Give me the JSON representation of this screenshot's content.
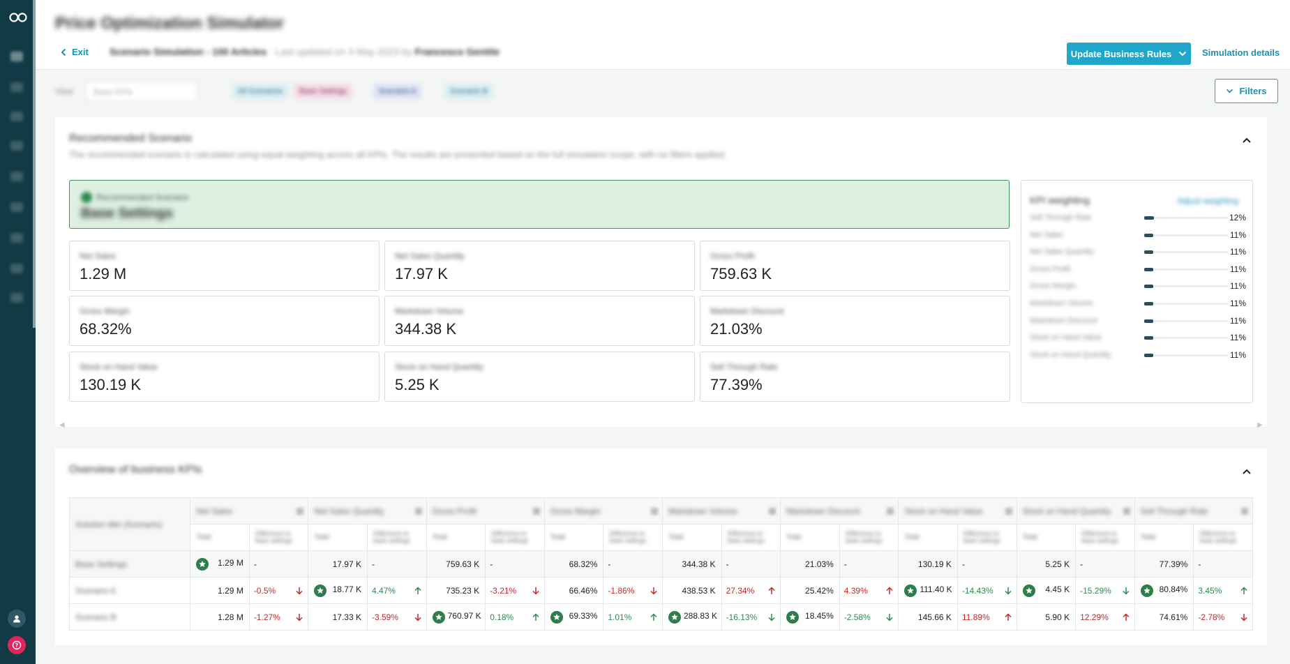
{
  "header": {
    "title": "Price Optimization Simulator",
    "exit_label": "Exit",
    "simulation_name": "Scenario Simulation - 100 Articles",
    "last_updated": "· Last updated on 3 May 2023 by",
    "updated_by": "Francesco Gentile",
    "update_rules_label": "Update Business Rules",
    "sim_details_label": "Simulation details"
  },
  "filter_bar": {
    "view_label": "View",
    "view_value": "Base KPIs",
    "chips": [
      "All Scenarios",
      "Base Settings",
      "Scenario A",
      "Scenario B"
    ],
    "filters_label": "Filters"
  },
  "recommended": {
    "title": "Recommended Scenario",
    "description": "The recommended scenario is calculated using equal weighting across all KPIs. The results are presented based on the full simulation scope, with no filters applied.",
    "banner_label": "Recommended Scenario",
    "banner_name": "Base Settings",
    "kpis": [
      {
        "label": "Net Sales",
        "value": "1.29 M"
      },
      {
        "label": "Net Sales Quantity",
        "value": "17.97 K"
      },
      {
        "label": "Gross Profit",
        "value": "759.63 K"
      },
      {
        "label": "Gross Margin",
        "value": "68.32%"
      },
      {
        "label": "Markdown Volume",
        "value": "344.38 K"
      },
      {
        "label": "Markdown Discount",
        "value": "21.03%"
      },
      {
        "label": "Stock on Hand Value",
        "value": "130.19 K"
      },
      {
        "label": "Stock on Hand Quantity",
        "value": "5.25 K"
      },
      {
        "label": "Sell Through Rate",
        "value": "77.39%"
      }
    ],
    "weighting": {
      "title": "KPI weighting",
      "link": "Adjust weighting",
      "rows": [
        {
          "label": "Sell Through Rate",
          "value": "12%",
          "fraction": 0.12
        },
        {
          "label": "Net Sales",
          "value": "11%",
          "fraction": 0.11
        },
        {
          "label": "Net Sales Quantity",
          "value": "11%",
          "fraction": 0.11
        },
        {
          "label": "Gross Profit",
          "value": "11%",
          "fraction": 0.11
        },
        {
          "label": "Gross Margin",
          "value": "11%",
          "fraction": 0.11
        },
        {
          "label": "Markdown Volume",
          "value": "11%",
          "fraction": 0.11
        },
        {
          "label": "Markdown Discount",
          "value": "11%",
          "fraction": 0.11
        },
        {
          "label": "Stock on Hand Value",
          "value": "11%",
          "fraction": 0.11
        },
        {
          "label": "Stock on Hand Quantity",
          "value": "11%",
          "fraction": 0.11
        }
      ]
    }
  },
  "overview": {
    "title": "Overview of business KPIs",
    "first_col_header": "Solution title (Scenario)",
    "columns": [
      "Net Sales",
      "Net Sales Quantity",
      "Gross Profit",
      "Gross Margin",
      "Markdown Volume",
      "Markdown Discount",
      "Stock on Hand Value",
      "Stock on Hand Quantity",
      "Sell Through Rate"
    ],
    "sub_total": "Total",
    "sub_diff": "Difference to base settings",
    "rows": [
      {
        "name": "Base Settings",
        "cells": [
          {
            "v": "1.29 M",
            "star": true,
            "d": "-",
            "dir": ""
          },
          {
            "v": "17.97 K",
            "star": false,
            "d": "-",
            "dir": ""
          },
          {
            "v": "759.63 K",
            "star": false,
            "d": "-",
            "dir": ""
          },
          {
            "v": "68.32%",
            "star": false,
            "d": "-",
            "dir": ""
          },
          {
            "v": "344.38 K",
            "star": false,
            "d": "-",
            "dir": ""
          },
          {
            "v": "21.03%",
            "star": false,
            "d": "-",
            "dir": ""
          },
          {
            "v": "130.19 K",
            "star": false,
            "d": "-",
            "dir": ""
          },
          {
            "v": "5.25 K",
            "star": false,
            "d": "-",
            "dir": ""
          },
          {
            "v": "77.39%",
            "star": false,
            "d": "-",
            "dir": ""
          }
        ]
      },
      {
        "name": "Scenario A",
        "cells": [
          {
            "v": "1.29 M",
            "star": false,
            "d": "-0.5%",
            "dir": "down",
            "tone": "neg"
          },
          {
            "v": "18.77 K",
            "star": true,
            "d": "4.47%",
            "dir": "up",
            "tone": "pos"
          },
          {
            "v": "735.23 K",
            "star": false,
            "d": "-3.21%",
            "dir": "down",
            "tone": "neg"
          },
          {
            "v": "66.46%",
            "star": false,
            "d": "-1.86%",
            "dir": "down",
            "tone": "neg"
          },
          {
            "v": "438.53 K",
            "star": false,
            "d": "27.34%",
            "dir": "up",
            "tone": "neg"
          },
          {
            "v": "25.42%",
            "star": false,
            "d": "4.39%",
            "dir": "up",
            "tone": "neg"
          },
          {
            "v": "111.40 K",
            "star": true,
            "d": "-14.43%",
            "dir": "down",
            "tone": "pos"
          },
          {
            "v": "4.45 K",
            "star": true,
            "d": "-15.29%",
            "dir": "down",
            "tone": "pos"
          },
          {
            "v": "80.84%",
            "star": true,
            "d": "3.45%",
            "dir": "up",
            "tone": "pos"
          }
        ]
      },
      {
        "name": "Scenario B",
        "cells": [
          {
            "v": "1.28 M",
            "star": false,
            "d": "-1.27%",
            "dir": "down",
            "tone": "neg"
          },
          {
            "v": "17.33 K",
            "star": false,
            "d": "-3.59%",
            "dir": "down",
            "tone": "neg"
          },
          {
            "v": "760.97 K",
            "star": true,
            "d": "0.18%",
            "dir": "up",
            "tone": "pos"
          },
          {
            "v": "69.33%",
            "star": true,
            "d": "1.01%",
            "dir": "up",
            "tone": "pos"
          },
          {
            "v": "288.83 K",
            "star": true,
            "d": "-16.13%",
            "dir": "down",
            "tone": "pos"
          },
          {
            "v": "18.45%",
            "star": true,
            "d": "-2.58%",
            "dir": "down",
            "tone": "pos"
          },
          {
            "v": "145.66 K",
            "star": false,
            "d": "11.89%",
            "dir": "up",
            "tone": "neg"
          },
          {
            "v": "5.90 K",
            "star": false,
            "d": "12.29%",
            "dir": "up",
            "tone": "neg"
          },
          {
            "v": "74.61%",
            "star": false,
            "d": "-2.78%",
            "dir": "down",
            "tone": "neg"
          }
        ]
      }
    ]
  },
  "colors": {
    "sidebar": "#123a44",
    "accent": "#1fa6c8",
    "positive": "#2e8b4e",
    "negative": "#c62828",
    "recommended_bg": "#ddf0e2"
  },
  "icons": [
    "logo-icon",
    "chevron-left-icon",
    "chevron-down-icon",
    "chevron-up-icon",
    "star-icon",
    "arrow-up-icon",
    "arrow-down-icon",
    "user-icon",
    "help-icon"
  ]
}
